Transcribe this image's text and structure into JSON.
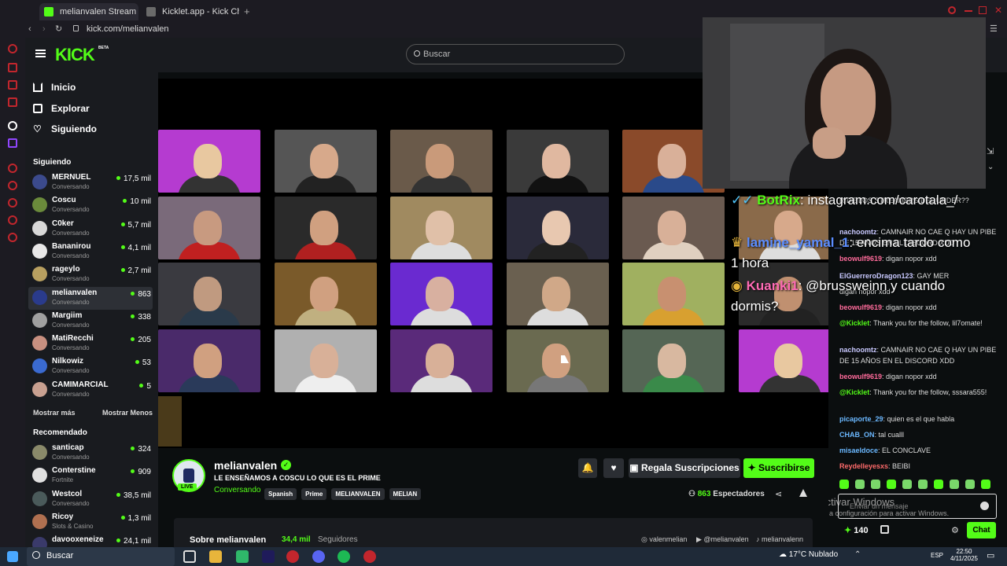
{
  "browser": {
    "tabs": [
      {
        "label": "melianvalen Stream -"
      },
      {
        "label": "Kicklet.app - Kick Chatbo"
      }
    ],
    "url": "kick.com/melianvalen"
  },
  "header": {
    "logo": "KICK",
    "logo_badge": "BETA",
    "search_placeholder": "Buscar"
  },
  "sidebar": {
    "nav": [
      {
        "label": "Inicio",
        "icon": "home-icon"
      },
      {
        "label": "Explorar",
        "icon": "compass-icon"
      },
      {
        "label": "Siguiendo",
        "icon": "heart-icon"
      }
    ],
    "following_title": "Siguiendo",
    "following": [
      {
        "name": "MERNUEL",
        "status": "Conversando",
        "viewers": "17,5 mil",
        "color": "#3b4a8c"
      },
      {
        "name": "Coscu",
        "status": "Conversando",
        "viewers": "10 mil",
        "color": "#6a8a3b"
      },
      {
        "name": "C0ker",
        "status": "Conversando",
        "viewers": "5,7 mil",
        "color": "#d8d8d8"
      },
      {
        "name": "Bananirou",
        "status": "Conversando",
        "viewers": "4,1 mil",
        "color": "#e8e8e8"
      },
      {
        "name": "rageylo",
        "status": "Conversando",
        "viewers": "2,7 mil",
        "color": "#b8a060"
      },
      {
        "name": "melianvalen",
        "status": "Conversando",
        "viewers": "863",
        "color": "#2a3b8c"
      },
      {
        "name": "Margiim",
        "status": "Conversando",
        "viewers": "338",
        "color": "#a0a0a0"
      },
      {
        "name": "MatiRecchi",
        "status": "Conversando",
        "viewers": "205",
        "color": "#c89080"
      },
      {
        "name": "Nilkowiz",
        "status": "Conversando",
        "viewers": "53",
        "color": "#3a6ad0"
      },
      {
        "name": "CAMIMARCIAL",
        "status": "Conversando",
        "viewers": "5",
        "color": "#c8a090"
      }
    ],
    "show_more": "Mostrar más",
    "show_less": "Mostrar Menos",
    "recommended_title": "Recomendado",
    "recommended": [
      {
        "name": "santicap",
        "status": "Conversando",
        "viewers": "324",
        "color": "#8a8a6a"
      },
      {
        "name": "Conterstine",
        "status": "Fortnite",
        "viewers": "909",
        "color": "#e0e0e0"
      },
      {
        "name": "Westcol",
        "status": "Conversando",
        "viewers": "38,5 mil",
        "color": "#4a5a5a"
      },
      {
        "name": "Ricoy",
        "status": "Slots & Casino",
        "viewers": "1,3 mil",
        "color": "#b07050"
      },
      {
        "name": "davooxeneize",
        "status": "",
        "viewers": "24,1 mil",
        "color": "#3a3a6a"
      }
    ]
  },
  "chat": {
    "overlay": [
      {
        "user": "BotRix",
        "text": ": instagram.com/carotala_/"
      },
      {
        "user": "lamine_yamal_1",
        "text": ": encima tardo como"
      },
      {
        "user": "",
        "text": "1 hora"
      },
      {
        "user": "Kuanki1",
        "text": ": @brussweinn y cuando"
      },
      {
        "user": "",
        "text": "dormis?"
      }
    ],
    "messages": [
      {
        "user": "",
        "text": "R DE LOS STREAMERS DEL UNDER??",
        "color": "#ddd"
      },
      {
        "user": "nachoomtz",
        "text": ": CAMNAIR NO CAE Q HAY UN PIBE DE 15 AÑOS EN EL DISCORD XDD",
        "color": "#c9c9ff"
      },
      {
        "user": "beowulf9619",
        "text": ": digan nopor xdd",
        "color": "#ff6b9b"
      },
      {
        "user": "ElGuerreroDragon123",
        "text": ": GAY MER",
        "color": "#c9c9ff"
      },
      {
        "user": "",
        "text": "digan nopor xdd",
        "color": "#ddd"
      },
      {
        "user": "beowulf9619",
        "text": ": digan nopor xdd",
        "color": "#ff6b9b"
      },
      {
        "user": "@Kicklet",
        "text": ": Thank you for the follow, lil7omate!",
        "color": "#53fc18"
      },
      {
        "user": "nachoomtz",
        "text": ": CAMNAIR NO CAE Q HAY UN PIBE DE 15 AÑOS EN EL DISCORD XDD",
        "color": "#c9c9ff"
      },
      {
        "user": "beowulf9619",
        "text": ": digan nopor xdd",
        "color": "#ff6b9b"
      },
      {
        "user": "@Kicklet",
        "text": ": Thank you for the follow, sssara555!",
        "color": "#53fc18"
      },
      {
        "user": "picaporte_29",
        "text": ": quien es el que habla",
        "color": "#6bb8ff"
      },
      {
        "user": "CHAB_ON",
        "text": ": tal cualll",
        "color": "#6bb8ff"
      },
      {
        "user": "misaeldoce",
        "text": ": EL CONCLAVE",
        "color": "#6bb8ff"
      },
      {
        "user": "Reydelleyesxs",
        "text": ": BEIBI",
        "color": "#ff6b6b"
      }
    ],
    "input_placeholder": "Enviar un mensaje",
    "points": "140",
    "send_label": "Chat",
    "activate_line1": "Activar Windows",
    "activate_line2": "Ve a configuración para activar Windows."
  },
  "stream": {
    "channel": "melianvalen",
    "title": "LE ENSEÑAMOS A COSCU LO QUE ES EL PRIME",
    "category": "Conversando",
    "tags": [
      "Spanish",
      "Prime",
      "MELIANVALEN",
      "MELIAN"
    ],
    "live_badge": "LIVE",
    "gift_label": "Regala Suscripciones",
    "subscribe_label": "Suscribirse",
    "viewers": "863",
    "viewers_label": "Espectadores",
    "about_label": "Sobre melianvalen",
    "followers": "34,4 mil",
    "followers_label": "Seguidores",
    "socials": [
      "valenmelian",
      "@melianvalen",
      "melianvalenn"
    ]
  },
  "taskbar": {
    "search_label": "Buscar",
    "weather_temp": "17°C",
    "weather_label": "Nublado",
    "lang": "ESP",
    "time": "22:50",
    "date": "4/11/2025"
  },
  "colors": {
    "kick_green": "#53fc18",
    "background": "#0b0e0f",
    "panel": "#191b1f"
  }
}
